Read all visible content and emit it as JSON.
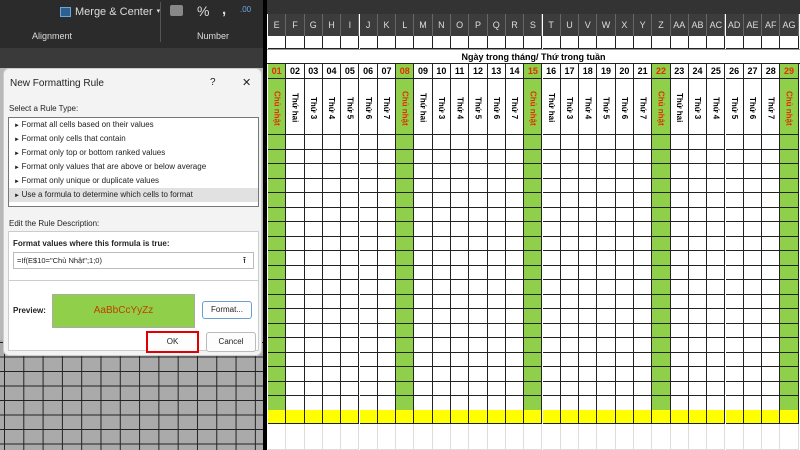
{
  "ribbon": {
    "merge_center": "Merge & Center",
    "percent": "%",
    "comma": ",",
    "alignment_label": "Alignment",
    "number_label": "Number"
  },
  "dialog": {
    "title": "New Formatting Rule",
    "help": "?",
    "close": "✕",
    "select_rule_label": "Select a Rule Type:",
    "rule_types": [
      "Format all cells based on their values",
      "Format only cells that contain",
      "Format only top or bottom ranked values",
      "Format only values that are above or below average",
      "Format only unique or duplicate values",
      "Use a formula to determine which cells to format"
    ],
    "selected_rule_index": 5,
    "edit_label": "Edit the Rule Description:",
    "formula_label": "Format values where this formula is true:",
    "formula_value": "=If(E$10=\"Chủ Nhật\";1;0)",
    "preview_label": "Preview:",
    "preview_text": "AaBbCcYyZz",
    "format_button": "Format...",
    "ok_button": "OK",
    "cancel_button": "Cancel"
  },
  "sheet": {
    "columns": [
      "E",
      "F",
      "G",
      "H",
      "I",
      "J",
      "K",
      "L",
      "M",
      "N",
      "O",
      "P",
      "Q",
      "R",
      "S",
      "T",
      "U",
      "V",
      "W",
      "X",
      "Y",
      "Z",
      "AA",
      "AB",
      "AC",
      "AD",
      "AE",
      "AF",
      "AG"
    ],
    "title": "Ngày trong tháng/ Thứ trong tuần",
    "days": [
      "01",
      "02",
      "03",
      "04",
      "05",
      "06",
      "07",
      "08",
      "09",
      "10",
      "11",
      "12",
      "13",
      "14",
      "15",
      "16",
      "17",
      "18",
      "19",
      "20",
      "21",
      "22",
      "23",
      "24",
      "25",
      "26",
      "27",
      "28",
      "29"
    ],
    "weekdays": [
      "Chủ nhật",
      "Thứ hai",
      "Thứ 3",
      "Thứ 4",
      "Thứ 5",
      "Thứ 6",
      "Thứ 7",
      "Chủ nhật",
      "Thứ hai",
      "Thứ 3",
      "Thứ 4",
      "Thứ 5",
      "Thứ 6",
      "Thứ 7",
      "Chủ nhật",
      "Thứ hai",
      "Thứ 3",
      "Thứ 4",
      "Thứ 5",
      "Thứ 6",
      "Thứ 7",
      "Chủ nhật",
      "Thứ hai",
      "Thứ 3",
      "Thứ 4",
      "Thứ 5",
      "Thứ 6",
      "Thứ 7",
      "Chủ nhật"
    ],
    "sunday_color": "#8fcf4a",
    "total_row_color": "#ffff00"
  }
}
